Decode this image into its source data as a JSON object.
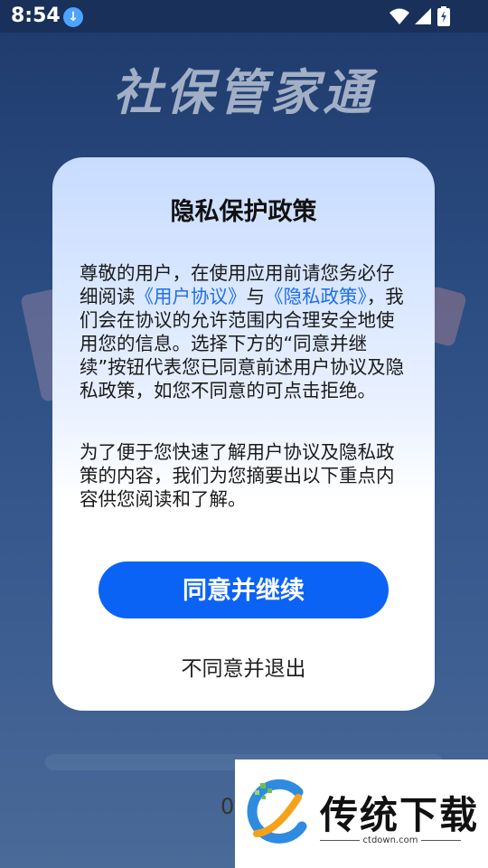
{
  "status_bar": {
    "time": "8:54"
  },
  "background": {
    "app_title": "社保管家通",
    "partial_text": "0"
  },
  "dialog": {
    "title": "隐私保护政策",
    "para1": {
      "text_a": "尊敬的用户，在使用应用前请您务必仔细阅读",
      "link_user_agreement": "《用户协议》",
      "text_b": "与",
      "link_privacy_policy": "《隐私政策》",
      "text_c": "，我们会在协议的允许范围内合理安全地使用您的信息。选择下方的“同意并继续”按钮代表您已同意前述用户协议及隐私政策，如您不同意的可点击拒绝。"
    },
    "para2": " 为了便于您快速了解用户协议及隐私政策的内容，我们为您摘要出以下重点内容供您阅读和了解。",
    "agree_label": "同意并继续",
    "decline_label": "不同意并退出"
  },
  "watermark": {
    "name": "传统下载",
    "url": "ctdown.com"
  },
  "colors": {
    "accent": "#0b63f6",
    "link": "#1f6fe8"
  }
}
